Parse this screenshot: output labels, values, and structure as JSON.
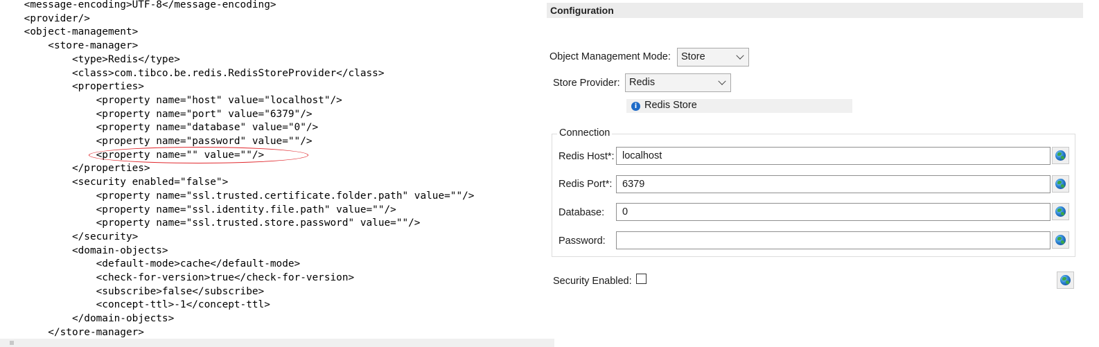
{
  "xml_editor": {
    "lines": [
      {
        "text": "    <message-encoding>UTF-8</message-encoding>"
      },
      {
        "text": "    <provider/>"
      },
      {
        "text": "    <object-management>"
      },
      {
        "text": "        <store-manager>"
      },
      {
        "text": "            <type>Redis</type>"
      },
      {
        "text": "            <class>com.tibco.be.redis.RedisStoreProvider</class>"
      },
      {
        "text": "            <properties>"
      },
      {
        "text": "                <property name=\"host\" value=\"localhost\"/>"
      },
      {
        "text": "                <property name=\"port\" value=\"6379\"/>"
      },
      {
        "text": "                <property name=\"database\" value=\"0\"/>"
      },
      {
        "text": "                <property name=\"password\" value=\"\"/>"
      },
      {
        "text": "                <property name=\"\" value=\"\"/>"
      },
      {
        "text": "            </properties>"
      },
      {
        "text": "            <security enabled=\"false\">"
      },
      {
        "text": "                <property name=\"ssl.trusted.certificate.folder.path\" value=\"\"/>"
      },
      {
        "text": "                <property name=\"ssl.identity.file.path\" value=\"\"/>"
      },
      {
        "text": "                <property name=\"ssl.trusted.store.password\" value=\"\"/>"
      },
      {
        "text": "            </security>"
      },
      {
        "text": "            <domain-objects>"
      },
      {
        "text": "                <default-mode>cache</default-mode>"
      },
      {
        "text": "                <check-for-version>true</check-for-version>"
      },
      {
        "text": "                <subscribe>false</subscribe>"
      },
      {
        "text": "                <concept-ttl>-1</concept-ttl>"
      },
      {
        "text": "            </domain-objects>"
      },
      {
        "text": "        </store-manager>"
      }
    ],
    "highlight_color": "#e0282d"
  },
  "config": {
    "header": "Configuration",
    "object_management_mode": {
      "label": "Object Management Mode:",
      "value": "Store"
    },
    "store_provider": {
      "label": "Store Provider:",
      "value": "Redis"
    },
    "info": {
      "icon": "info-icon",
      "text": "Redis Store"
    },
    "connection": {
      "legend": "Connection",
      "host": {
        "label": "Redis Host*:",
        "value": "localhost"
      },
      "port": {
        "label": "Redis Port*:",
        "value": "6379"
      },
      "database": {
        "label": "Database:",
        "value": "0"
      },
      "password": {
        "label": "Password:",
        "value": ""
      }
    },
    "security_enabled": {
      "label": "Security Enabled:",
      "checked": false
    },
    "global_var_icon": "globe-icon"
  }
}
